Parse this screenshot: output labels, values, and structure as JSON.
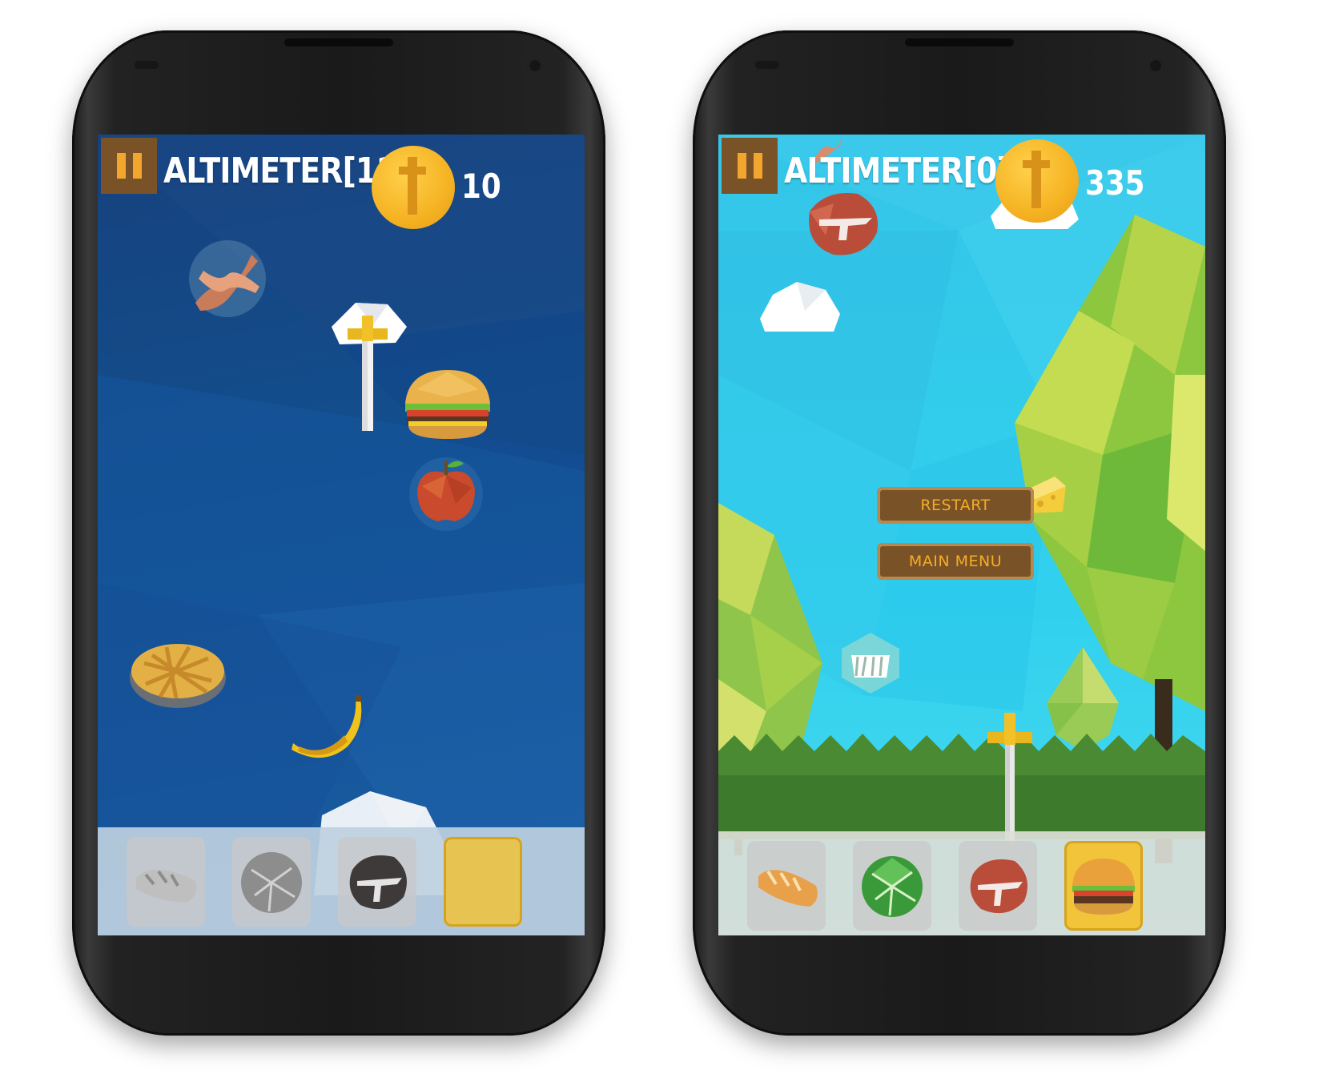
{
  "screens": [
    {
      "altimeter": "ALTIMETER[119]",
      "coins": "10",
      "pause_icon": "pause-icon",
      "floating_items": [
        "bacon",
        "coin-cloud",
        "sword",
        "hamburger",
        "apple",
        "pie",
        "banana"
      ],
      "inventory": [
        "bread",
        "cabbage",
        "steak",
        "selected-empty"
      ]
    },
    {
      "altimeter": "ALTIMETER[0]",
      "coins": "335",
      "pause_icon": "pause-icon",
      "menu": {
        "restart_label": "RESTART",
        "main_menu_label": "MAIN MENU"
      },
      "floating_items": [
        "steak",
        "cloud",
        "cheese",
        "crate",
        "sword",
        "bacon"
      ],
      "inventory": [
        "bread",
        "cabbage",
        "steak",
        "hamburger"
      ],
      "scenery": [
        "low-poly-tree",
        "low-poly-tree",
        "small-tree",
        "hedge"
      ]
    }
  ],
  "colors": {
    "night_sky": "#16417d",
    "day_sky": "#34c5e8",
    "button_brown": "#7a5227",
    "button_text": "#f3ad27",
    "coin_gold": "#f5b323"
  }
}
